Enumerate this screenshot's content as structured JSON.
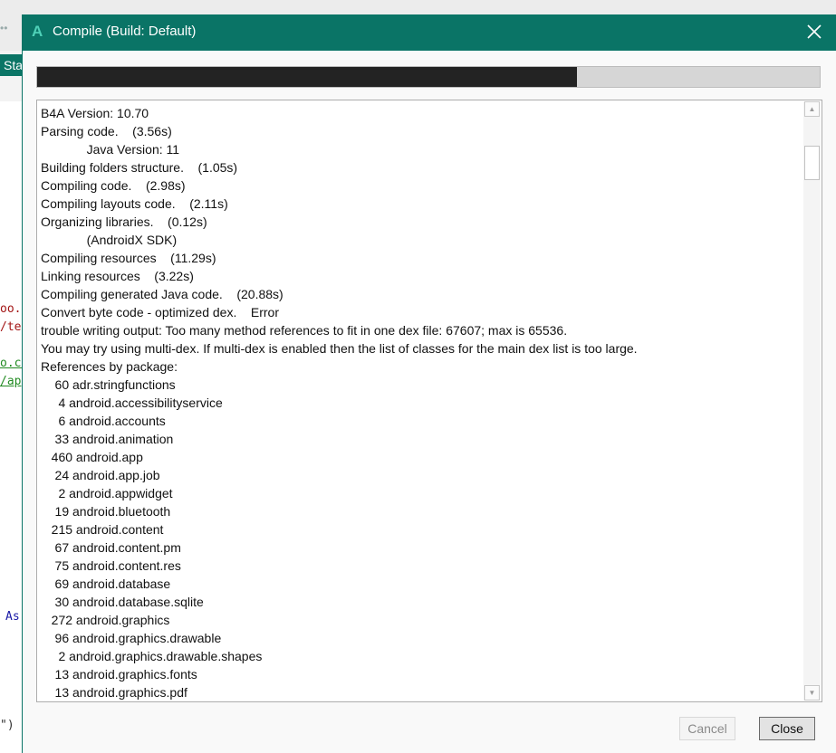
{
  "background": {
    "tab_fragment": "Sta",
    "code_fragments": [
      {
        "text": "oo.c",
        "color": "#a31515"
      },
      {
        "text": "/te",
        "color": "#a31515"
      },
      {
        "text": "o.co",
        "color": "#228b22"
      },
      {
        "text": "/ap",
        "color": "#228b22"
      },
      {
        "text": "As",
        "color": "#1a1aa6"
      },
      {
        "text": "\")",
        "color": "#333333"
      }
    ]
  },
  "dialog": {
    "app_icon": "A",
    "title": "Compile (Build: Default)",
    "title_bar_color": "#0a7466",
    "close_icon": "close-icon",
    "progress_percent": 69,
    "log_lines": [
      "B4A Version: 10.70",
      "Parsing code.    (3.56s)",
      "             Java Version: 11",
      "Building folders structure.    (1.05s)",
      "Compiling code.    (2.98s)",
      "Compiling layouts code.    (2.11s)",
      "Organizing libraries.    (0.12s)",
      "             (AndroidX SDK)",
      "Compiling resources    (11.29s)",
      "Linking resources    (3.22s)",
      "Compiling generated Java code.    (20.88s)",
      "Convert byte code - optimized dex.    Error",
      "trouble writing output: Too many method references to fit in one dex file: 67607; max is 65536.",
      "You may try using multi-dex. If multi-dex is enabled then the list of classes for the main dex list is too large.",
      "References by package:",
      "    60 adr.stringfunctions",
      "     4 android.accessibilityservice",
      "     6 android.accounts",
      "    33 android.animation",
      "   460 android.app",
      "    24 android.app.job",
      "     2 android.appwidget",
      "    19 android.bluetooth",
      "   215 android.content",
      "    67 android.content.pm",
      "    75 android.content.res",
      "    69 android.database",
      "    30 android.database.sqlite",
      "   272 android.graphics",
      "    96 android.graphics.drawable",
      "     2 android.graphics.drawable.shapes",
      "    13 android.graphics.fonts",
      "    13 android.graphics.pdf"
    ],
    "scroll_position_percent": 5,
    "scroll_visible_percent": 6,
    "cancel_label": "Cancel",
    "close_label": "Close"
  }
}
